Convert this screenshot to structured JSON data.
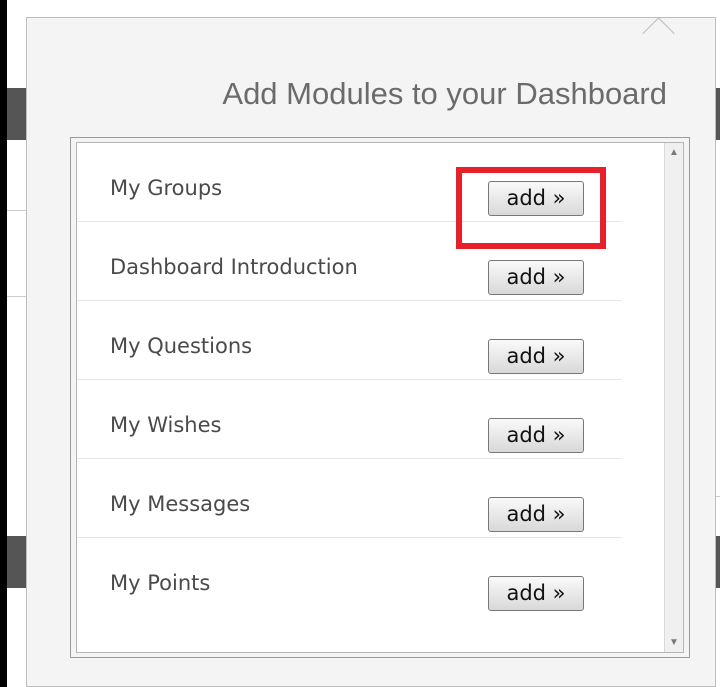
{
  "popup": {
    "title": "Add Modules to your Dashboard",
    "modules": [
      {
        "label": "My Groups",
        "button": "add »"
      },
      {
        "label": "Dashboard Introduction",
        "button": "add »"
      },
      {
        "label": "My Questions",
        "button": "add »"
      },
      {
        "label": "My Wishes",
        "button": "add »"
      },
      {
        "label": "My Messages",
        "button": "add »"
      },
      {
        "label": "My Points",
        "button": "add »"
      }
    ]
  },
  "scrollbar": {
    "up_icon": "▲",
    "down_icon": "▼"
  },
  "colors": {
    "highlight": "#e8202a",
    "background": "#000000"
  }
}
